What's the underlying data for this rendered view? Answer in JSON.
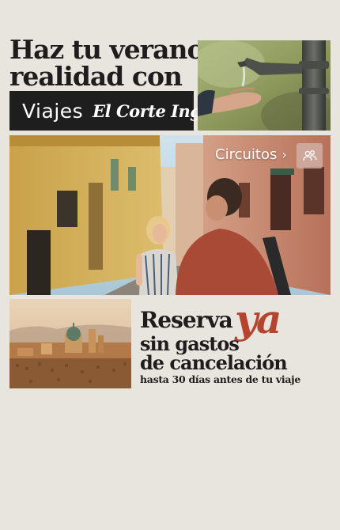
{
  "headline": {
    "line1": "Haz tu verano",
    "line2": "realidad con"
  },
  "brand": {
    "name": "Viajes",
    "partner": "El Corte Inglés"
  },
  "circuitos": {
    "label": "Circuitos",
    "icon": "people-icon"
  },
  "promo": {
    "reserva": "Reserva",
    "ya": "ya",
    "line2": "sin gastos",
    "line3": "de cancelación",
    "line4": "hasta 30 días antes de tu viaje"
  },
  "colors": {
    "background": "#e8e4de",
    "brand_bar": "#1f1e1e",
    "accent": "#b5442f",
    "text": "#1e1c1c"
  }
}
